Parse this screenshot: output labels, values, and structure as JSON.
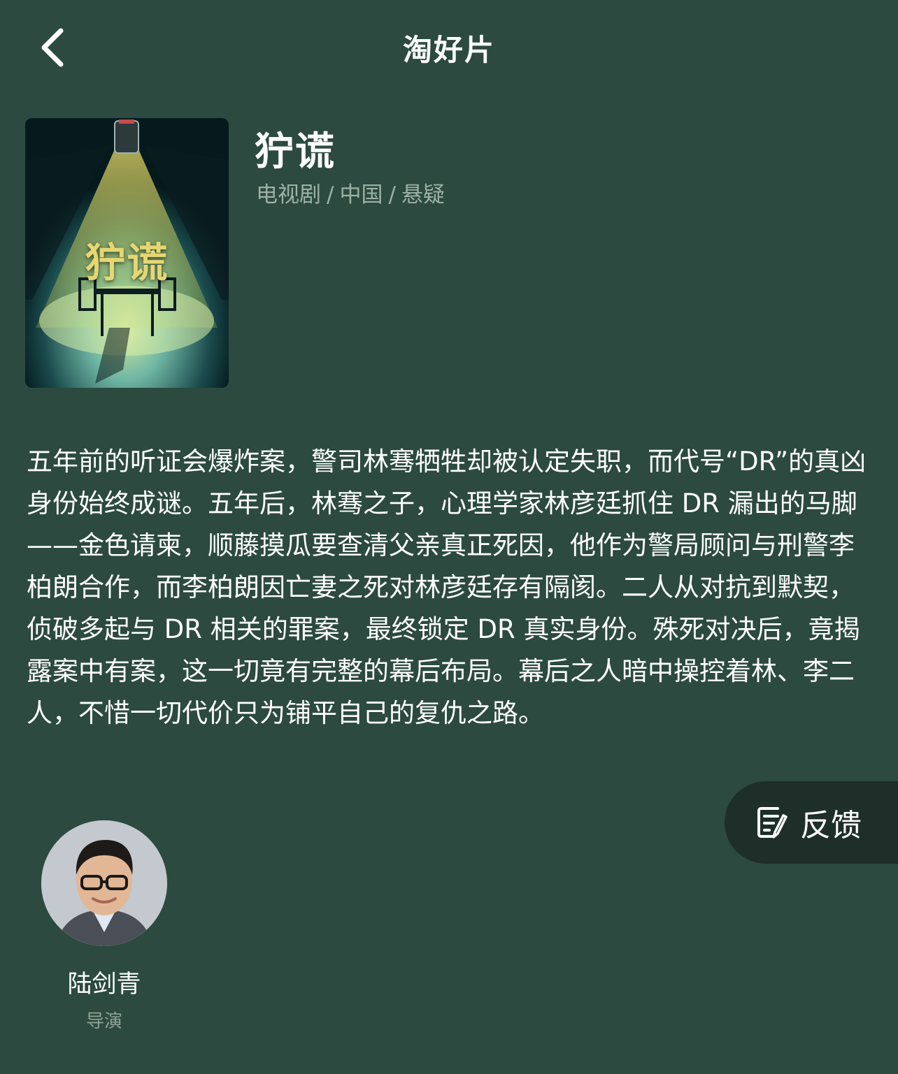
{
  "header": {
    "title": "淘好片",
    "back_icon": "chevron-left-icon"
  },
  "show": {
    "title": "狞谎",
    "poster_title": "狞谎",
    "meta": [
      "电视剧",
      "中国",
      "悬疑"
    ],
    "meta_separator": "/",
    "synopsis": "五年前的听证会爆炸案，警司林骞牺牲却被认定失职，而代号“DR”的真凶身份始终成谜。五年后，林骞之子，心理学家林彦廷抓住 DR 漏出的马脚——金色请柬，顺藤摸瓜要查清父亲真正死因，他作为警局顾问与刑警李柏朗合作，而李柏朗因亡妻之死对林彦廷存有隔阂。二人从对抗到默契，侦破多起与 DR 相关的罪案，最终锁定 DR 真实身份。殊死对决后，竟揭露案中有案，这一切竟有完整的幕后布局。幕后之人暗中操控着林、李二人，不惜一切代价只为铺平自己的复仇之路。"
  },
  "feedback": {
    "label": "反馈",
    "icon": "feedback-icon"
  },
  "crew": [
    {
      "name": "陆剑青",
      "role": "导演"
    }
  ],
  "colors": {
    "background": "#2c4a3f",
    "meta_text": "#9eb1a7",
    "feedback_bg": "#1d2f28",
    "poster_accent": "#e4d773"
  }
}
